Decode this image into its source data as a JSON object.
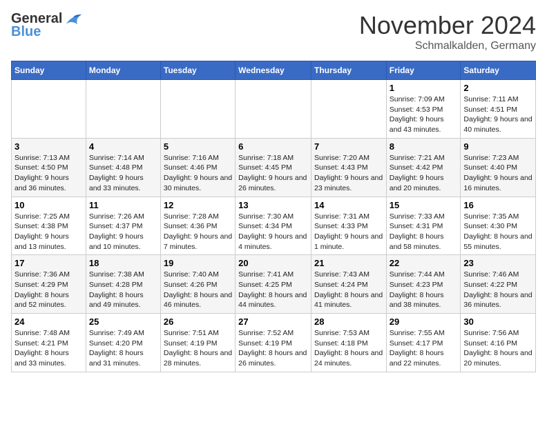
{
  "logo": {
    "general": "General",
    "blue": "Blue"
  },
  "header": {
    "month": "November 2024",
    "location": "Schmalkalden, Germany"
  },
  "weekdays": [
    "Sunday",
    "Monday",
    "Tuesday",
    "Wednesday",
    "Thursday",
    "Friday",
    "Saturday"
  ],
  "weeks": [
    [
      {
        "day": "",
        "info": ""
      },
      {
        "day": "",
        "info": ""
      },
      {
        "day": "",
        "info": ""
      },
      {
        "day": "",
        "info": ""
      },
      {
        "day": "",
        "info": ""
      },
      {
        "day": "1",
        "info": "Sunrise: 7:09 AM\nSunset: 4:53 PM\nDaylight: 9 hours and 43 minutes."
      },
      {
        "day": "2",
        "info": "Sunrise: 7:11 AM\nSunset: 4:51 PM\nDaylight: 9 hours and 40 minutes."
      }
    ],
    [
      {
        "day": "3",
        "info": "Sunrise: 7:13 AM\nSunset: 4:50 PM\nDaylight: 9 hours and 36 minutes."
      },
      {
        "day": "4",
        "info": "Sunrise: 7:14 AM\nSunset: 4:48 PM\nDaylight: 9 hours and 33 minutes."
      },
      {
        "day": "5",
        "info": "Sunrise: 7:16 AM\nSunset: 4:46 PM\nDaylight: 9 hours and 30 minutes."
      },
      {
        "day": "6",
        "info": "Sunrise: 7:18 AM\nSunset: 4:45 PM\nDaylight: 9 hours and 26 minutes."
      },
      {
        "day": "7",
        "info": "Sunrise: 7:20 AM\nSunset: 4:43 PM\nDaylight: 9 hours and 23 minutes."
      },
      {
        "day": "8",
        "info": "Sunrise: 7:21 AM\nSunset: 4:42 PM\nDaylight: 9 hours and 20 minutes."
      },
      {
        "day": "9",
        "info": "Sunrise: 7:23 AM\nSunset: 4:40 PM\nDaylight: 9 hours and 16 minutes."
      }
    ],
    [
      {
        "day": "10",
        "info": "Sunrise: 7:25 AM\nSunset: 4:38 PM\nDaylight: 9 hours and 13 minutes."
      },
      {
        "day": "11",
        "info": "Sunrise: 7:26 AM\nSunset: 4:37 PM\nDaylight: 9 hours and 10 minutes."
      },
      {
        "day": "12",
        "info": "Sunrise: 7:28 AM\nSunset: 4:36 PM\nDaylight: 9 hours and 7 minutes."
      },
      {
        "day": "13",
        "info": "Sunrise: 7:30 AM\nSunset: 4:34 PM\nDaylight: 9 hours and 4 minutes."
      },
      {
        "day": "14",
        "info": "Sunrise: 7:31 AM\nSunset: 4:33 PM\nDaylight: 9 hours and 1 minute."
      },
      {
        "day": "15",
        "info": "Sunrise: 7:33 AM\nSunset: 4:31 PM\nDaylight: 8 hours and 58 minutes."
      },
      {
        "day": "16",
        "info": "Sunrise: 7:35 AM\nSunset: 4:30 PM\nDaylight: 8 hours and 55 minutes."
      }
    ],
    [
      {
        "day": "17",
        "info": "Sunrise: 7:36 AM\nSunset: 4:29 PM\nDaylight: 8 hours and 52 minutes."
      },
      {
        "day": "18",
        "info": "Sunrise: 7:38 AM\nSunset: 4:28 PM\nDaylight: 8 hours and 49 minutes."
      },
      {
        "day": "19",
        "info": "Sunrise: 7:40 AM\nSunset: 4:26 PM\nDaylight: 8 hours and 46 minutes."
      },
      {
        "day": "20",
        "info": "Sunrise: 7:41 AM\nSunset: 4:25 PM\nDaylight: 8 hours and 44 minutes."
      },
      {
        "day": "21",
        "info": "Sunrise: 7:43 AM\nSunset: 4:24 PM\nDaylight: 8 hours and 41 minutes."
      },
      {
        "day": "22",
        "info": "Sunrise: 7:44 AM\nSunset: 4:23 PM\nDaylight: 8 hours and 38 minutes."
      },
      {
        "day": "23",
        "info": "Sunrise: 7:46 AM\nSunset: 4:22 PM\nDaylight: 8 hours and 36 minutes."
      }
    ],
    [
      {
        "day": "24",
        "info": "Sunrise: 7:48 AM\nSunset: 4:21 PM\nDaylight: 8 hours and 33 minutes."
      },
      {
        "day": "25",
        "info": "Sunrise: 7:49 AM\nSunset: 4:20 PM\nDaylight: 8 hours and 31 minutes."
      },
      {
        "day": "26",
        "info": "Sunrise: 7:51 AM\nSunset: 4:19 PM\nDaylight: 8 hours and 28 minutes."
      },
      {
        "day": "27",
        "info": "Sunrise: 7:52 AM\nSunset: 4:19 PM\nDaylight: 8 hours and 26 minutes."
      },
      {
        "day": "28",
        "info": "Sunrise: 7:53 AM\nSunset: 4:18 PM\nDaylight: 8 hours and 24 minutes."
      },
      {
        "day": "29",
        "info": "Sunrise: 7:55 AM\nSunset: 4:17 PM\nDaylight: 8 hours and 22 minutes."
      },
      {
        "day": "30",
        "info": "Sunrise: 7:56 AM\nSunset: 4:16 PM\nDaylight: 8 hours and 20 minutes."
      }
    ]
  ]
}
